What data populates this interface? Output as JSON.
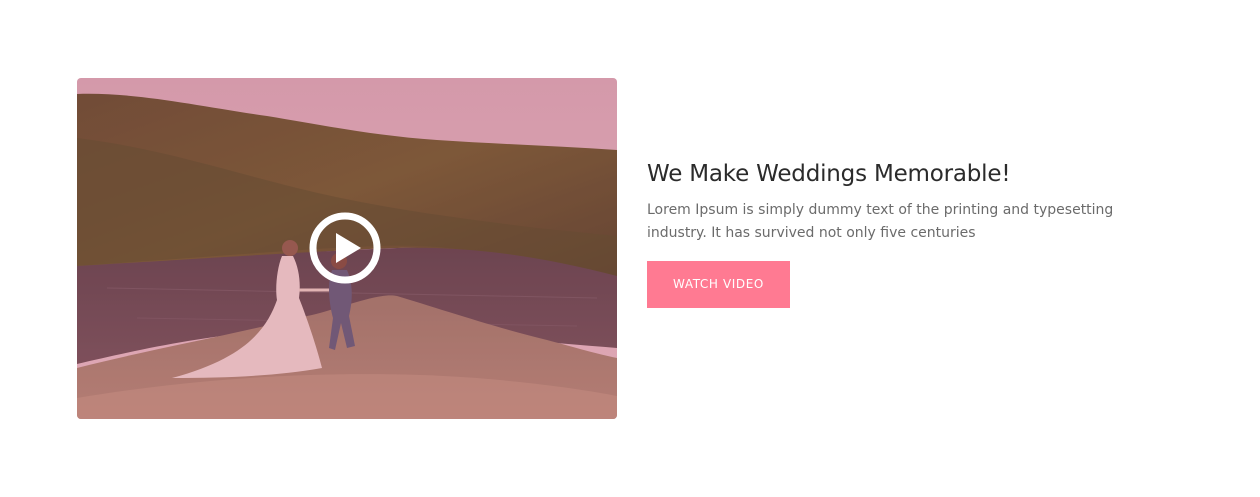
{
  "hero": {
    "title": "We Make Weddings Memorable!",
    "description": "Lorem Ipsum is simply dummy text of the printing and typesetting industry. It has survived not only five centuries",
    "button_label": "Watch Video"
  },
  "colors": {
    "accent": "#ff7a92",
    "title": "#2b2b2b",
    "body_text": "#6b6b6b",
    "image_tint": "#c2506a"
  },
  "icons": {
    "play": "play-icon"
  }
}
